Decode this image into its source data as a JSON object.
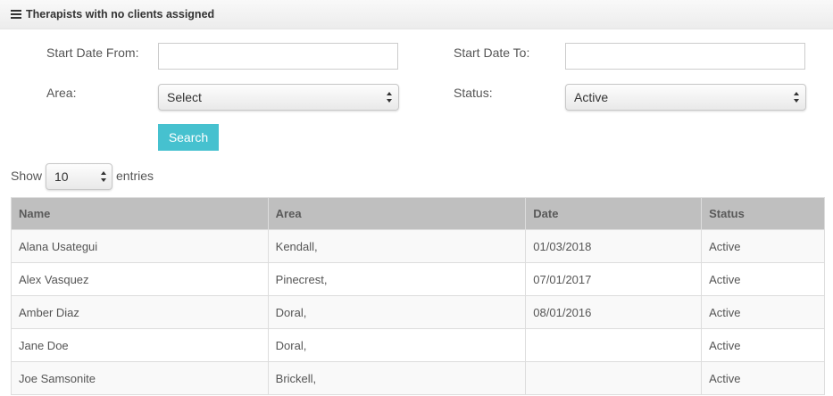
{
  "panel": {
    "title": "Therapists with no clients assigned",
    "icon": "menu-icon"
  },
  "filters": {
    "start_date_from_label": "Start Date From:",
    "start_date_from_value": "",
    "start_date_to_label": "Start Date To:",
    "start_date_to_value": "",
    "area_label": "Area:",
    "area_value": "Select",
    "status_label": "Status:",
    "status_value": "Active",
    "search_label": "Search",
    "search_color": "#46c1cf"
  },
  "length": {
    "show_label": "Show",
    "value": "10",
    "entries_label": "entries"
  },
  "table": {
    "columns": [
      "Name",
      "Area",
      "Date",
      "Status"
    ],
    "rows": [
      [
        "Alana Usategui",
        "Kendall,",
        "01/03/2018",
        "Active"
      ],
      [
        "Alex Vasquez",
        "Pinecrest,",
        "07/01/2017",
        "Active"
      ],
      [
        "Amber Diaz",
        "Doral,",
        "08/01/2016",
        "Active"
      ],
      [
        "Jane Doe",
        "Doral,",
        "",
        "Active"
      ],
      [
        "Joe Samsonite",
        "Brickell,",
        "",
        "Active"
      ]
    ]
  }
}
